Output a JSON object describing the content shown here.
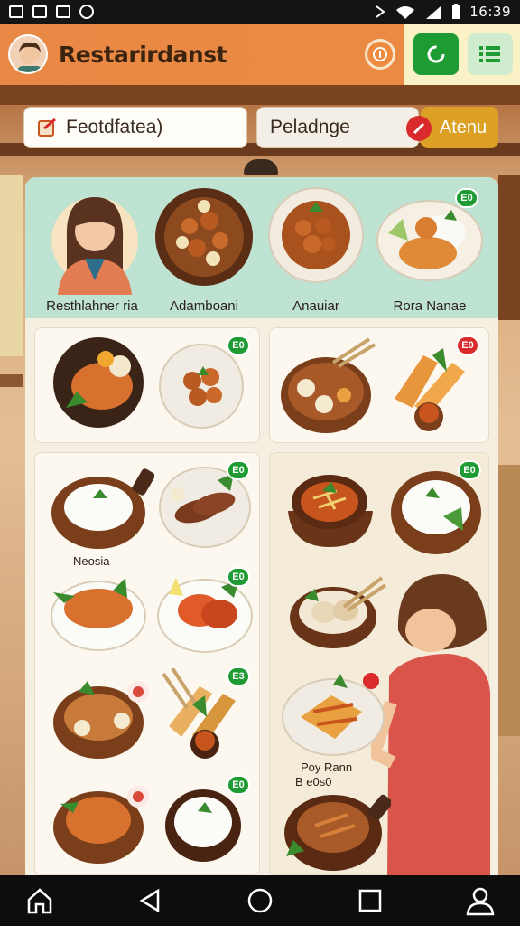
{
  "status_bar": {
    "time": "16:39"
  },
  "app_bar": {
    "title": "Restarirdanst"
  },
  "search": {
    "value": "Feotdfatea)"
  },
  "filter": {
    "label": "Peladnge"
  },
  "menu_button": {
    "label": "Atenu"
  },
  "featured": {
    "items": [
      {
        "label": "Resthlahner ria",
        "kind": "person"
      },
      {
        "label": "Adamboani",
        "kind": "dish"
      },
      {
        "label": "Anauiar",
        "kind": "dish"
      },
      {
        "label": "Rora Nanae",
        "kind": "dish",
        "badge": "E0"
      }
    ]
  },
  "dishes": {
    "badges": {
      "b1": "E0",
      "b2": "E0",
      "b3": "E0",
      "b4": "E0",
      "b5": "E3",
      "b6": "E0",
      "b7": "E0",
      "b8": "E0"
    },
    "labels": {
      "noodle": "Neosia",
      "poy1": "Poy Rann",
      "poy2": "B e0s0"
    }
  },
  "colors": {
    "app_bar": "#e98845",
    "accent_green": "#1e9b32",
    "menu_button": "#dba024",
    "featured_bg": "#bfe3d3"
  },
  "icons": {
    "nav": [
      "home-icon",
      "back-icon",
      "circle-home-icon",
      "recents-icon",
      "profile-icon"
    ]
  }
}
